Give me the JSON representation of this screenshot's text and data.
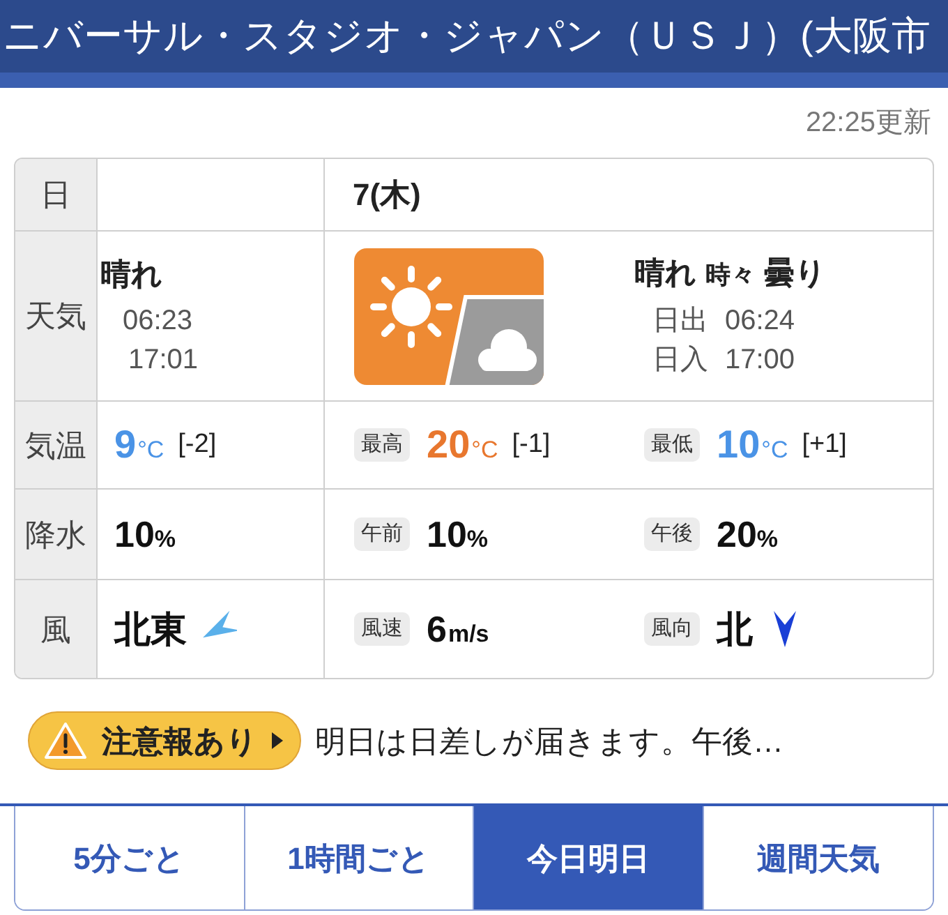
{
  "header": {
    "title": "ニバーサル・スタジオ・ジャパン（ＵＳＪ）(大阪市"
  },
  "updated": "22:25更新",
  "table": {
    "row_labels": [
      "日",
      "天気",
      "気温",
      "降水",
      "風"
    ],
    "date": "7(木)",
    "today_weather": {
      "condition": "晴れ",
      "sunrise": "06:23",
      "sunset": "17:01"
    },
    "tomorrow_weather": {
      "parts": [
        {
          "text": "晴れ",
          "kind": "main"
        },
        {
          "text": "時々",
          "kind": "minor"
        },
        {
          "text": "曇り",
          "kind": "main"
        }
      ],
      "sunrise_label": "日出",
      "sunrise": "06:24",
      "sunset_label": "日入",
      "sunset": "17:00"
    },
    "temperature": [
      {
        "value": "9",
        "unit": "°C",
        "diff": "[-2]",
        "color": "#4a93e6"
      },
      {
        "label": "最高",
        "value": "20",
        "unit": "°C",
        "diff": "[-1]",
        "color": "#e8772e"
      },
      {
        "label": "最低",
        "value": "10",
        "unit": "°C",
        "diff": "[+1]",
        "color": "#4a93e6"
      }
    ],
    "precipitation": [
      {
        "value": "10",
        "unit": "%"
      },
      {
        "label": "午前",
        "value": "10",
        "unit": "%"
      },
      {
        "label": "午後",
        "value": "20",
        "unit": "%"
      }
    ],
    "wind": [
      {
        "value": "北東"
      },
      {
        "label": "風速",
        "value": "6",
        "unit": "m/s"
      },
      {
        "label": "風向",
        "value": "北"
      }
    ]
  },
  "alert": {
    "badge": "注意報あり",
    "text": "明日は日差しが届きます。午後…"
  },
  "tabs": [
    {
      "label": "5分ごと",
      "selected": false
    },
    {
      "label": "1時間ごと",
      "selected": false
    },
    {
      "label": "今日明日",
      "selected": true
    },
    {
      "label": "週間天気",
      "selected": false
    }
  ]
}
